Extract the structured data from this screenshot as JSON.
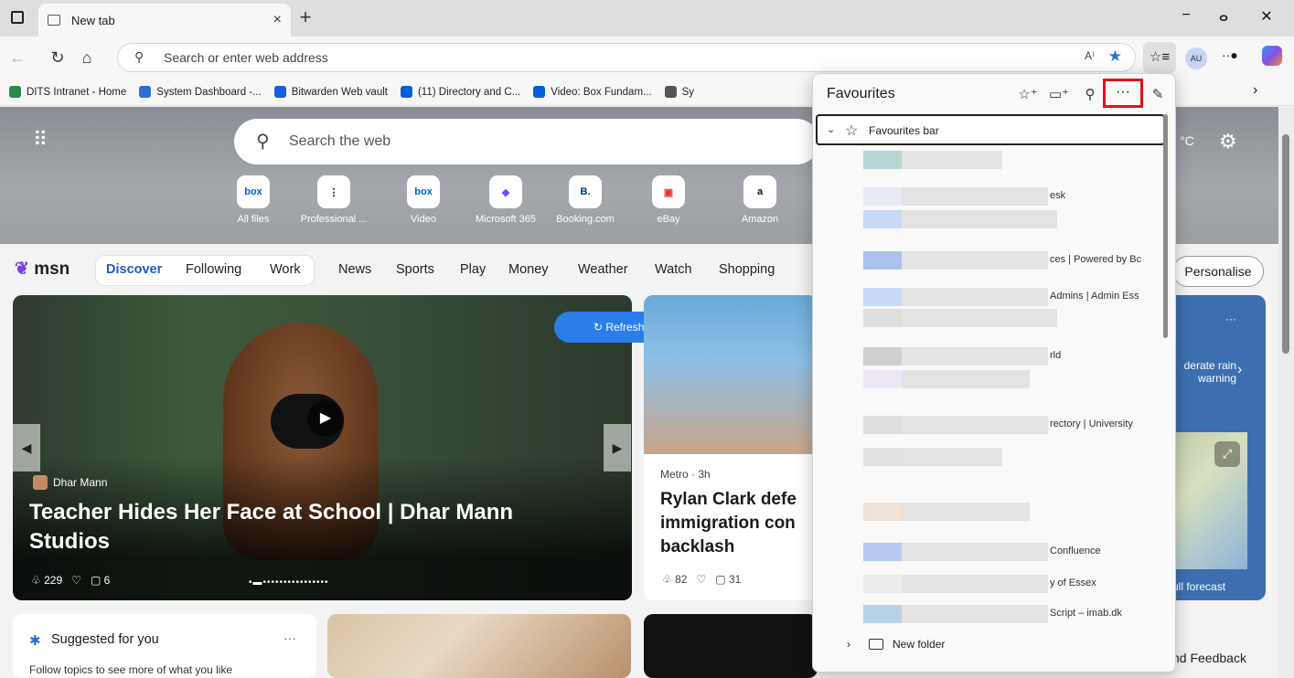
{
  "browser": {
    "tab_title": "New tab",
    "tab_close": "×",
    "new_tab": "+",
    "win_min": "−",
    "win_restore": "ⴰ",
    "win_close": "✕",
    "address_placeholder": "Search or enter web address",
    "profile": "AU"
  },
  "favorites_bar": [
    {
      "label": "DITS Intranet - Home",
      "color": "#2a8a4a"
    },
    {
      "label": "System Dashboard -...",
      "color": "#2b6fd6"
    },
    {
      "label": "Bitwarden Web vault",
      "color": "#175ddc"
    },
    {
      "label": "(11) Directory and C...",
      "color": "#0061d5"
    },
    {
      "label": "Video: Box Fundam...",
      "color": "#0061d5"
    },
    {
      "label": "Sy",
      "color": "#555555"
    }
  ],
  "newtab": {
    "search_placeholder": "Search the web",
    "temperature": "°C",
    "quicklinks": [
      {
        "label": "All files",
        "glyph": "box",
        "color": "#0061d5"
      },
      {
        "label": "Professional ...",
        "glyph": "⋮",
        "color": "#111111"
      },
      {
        "label": "Video",
        "glyph": "box",
        "color": "#0061d5"
      },
      {
        "label": "Microsoft 365",
        "glyph": "◆",
        "color": "#7a4ee8"
      },
      {
        "label": "Booking.com",
        "glyph": "B.",
        "color": "#003580"
      },
      {
        "label": "eBay",
        "glyph": "▣",
        "color": "#e53238"
      },
      {
        "label": "Amazon",
        "glyph": "a",
        "color": "#111111"
      }
    ]
  },
  "msn": {
    "logo": "msn",
    "nav": [
      "Discover",
      "Following",
      "Work",
      "News",
      "Sports",
      "Play",
      "Money",
      "Weather",
      "Watch",
      "Shopping"
    ],
    "personalise": "Personalise",
    "refresh": "Refresh stories"
  },
  "main_story": {
    "source": "Dhar Mann",
    "headline": "Teacher Hides Her Face at School | Dhar Mann Studios",
    "likes": "229",
    "comments": "6"
  },
  "second_story": {
    "source": "Metro · 3h",
    "headline": "Rylan Clark defe immigration con backlash",
    "likes": "82",
    "comments": "31"
  },
  "suggested": {
    "title": "Suggested for you",
    "subtitle": "Follow topics to see more of what you like",
    "more": "···"
  },
  "weather": {
    "more": "···",
    "warning": "derate rain warning",
    "forecast": "ull forecast"
  },
  "feedback": "nd Feedback",
  "favourites_panel": {
    "title": "Favourites",
    "more_button": "···",
    "folder_open": "Favourites bar",
    "items": [
      {
        "text": ""
      },
      {
        "text": "esk"
      },
      {
        "text": ""
      },
      {
        "text": "ces | Powered by Bc"
      },
      {
        "text": "Admins | Admin Ess"
      },
      {
        "text": ""
      },
      {
        "text": "rld"
      },
      {
        "text": ""
      },
      {
        "text": "rectory | University"
      },
      {
        "text": ""
      },
      {
        "text": ""
      },
      {
        "text": "Confluence"
      },
      {
        "text": "y of Essex"
      },
      {
        "text": "Script – imab.dk"
      }
    ],
    "new_folder": "New folder"
  }
}
